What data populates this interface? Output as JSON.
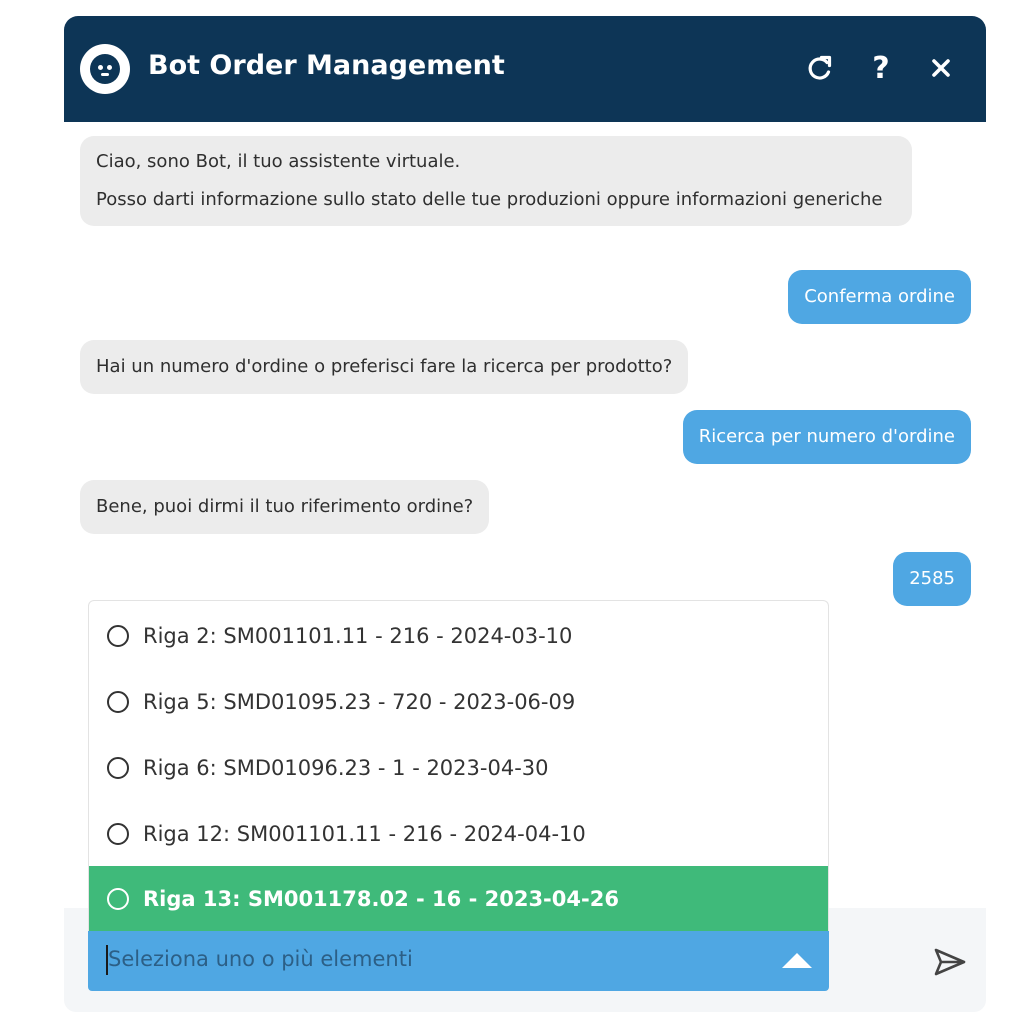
{
  "header": {
    "title": "Bot Order Management",
    "help_symbol": "?",
    "close_symbol": "✕",
    "background": "#0d3556"
  },
  "messages": [
    {
      "from": "bot",
      "lines": [
        "Ciao, sono Bot, il tuo assistente virtuale.",
        "Posso darti informazione sullo stato delle tue produzioni oppure informazioni generiche"
      ]
    },
    {
      "from": "user",
      "text": "Conferma ordine"
    },
    {
      "from": "bot",
      "text": "Hai un numero d'ordine o preferisci fare la ricerca per prodotto?"
    },
    {
      "from": "user",
      "text": "Ricerca per numero d'ordine"
    },
    {
      "from": "bot",
      "text": "Bene, puoi dirmi il tuo riferimento ordine?"
    },
    {
      "from": "user",
      "text": "2585"
    }
  ],
  "options": [
    {
      "label": "Riga 2: SM001101.11 - 216 - 2024-03-10",
      "selected": false,
      "highlighted": false
    },
    {
      "label": "Riga 5: SMD01095.23 - 720 - 2023-06-09",
      "selected": false,
      "highlighted": false
    },
    {
      "label": "Riga 6: SMD01096.23 - 1 - 2023-04-30",
      "selected": false,
      "highlighted": false
    },
    {
      "label": "Riga 12: SM001101.11 - 216 - 2024-04-10",
      "selected": false,
      "highlighted": false
    },
    {
      "label": "Riga 13: SM001178.02 - 16 - 2023-04-26",
      "selected": false,
      "highlighted": true
    }
  ],
  "input": {
    "placeholder": "Seleziona uno o più elementi"
  },
  "colors": {
    "user_bubble": "#4fa7e3",
    "bot_bubble": "#ececec",
    "highlight": "#3fba7a"
  },
  "icons": {
    "avatar": "bot-face-icon",
    "refresh": "refresh-icon",
    "help": "help-icon",
    "close": "close-icon",
    "dropdown": "caret-up-icon",
    "send": "send-icon"
  }
}
